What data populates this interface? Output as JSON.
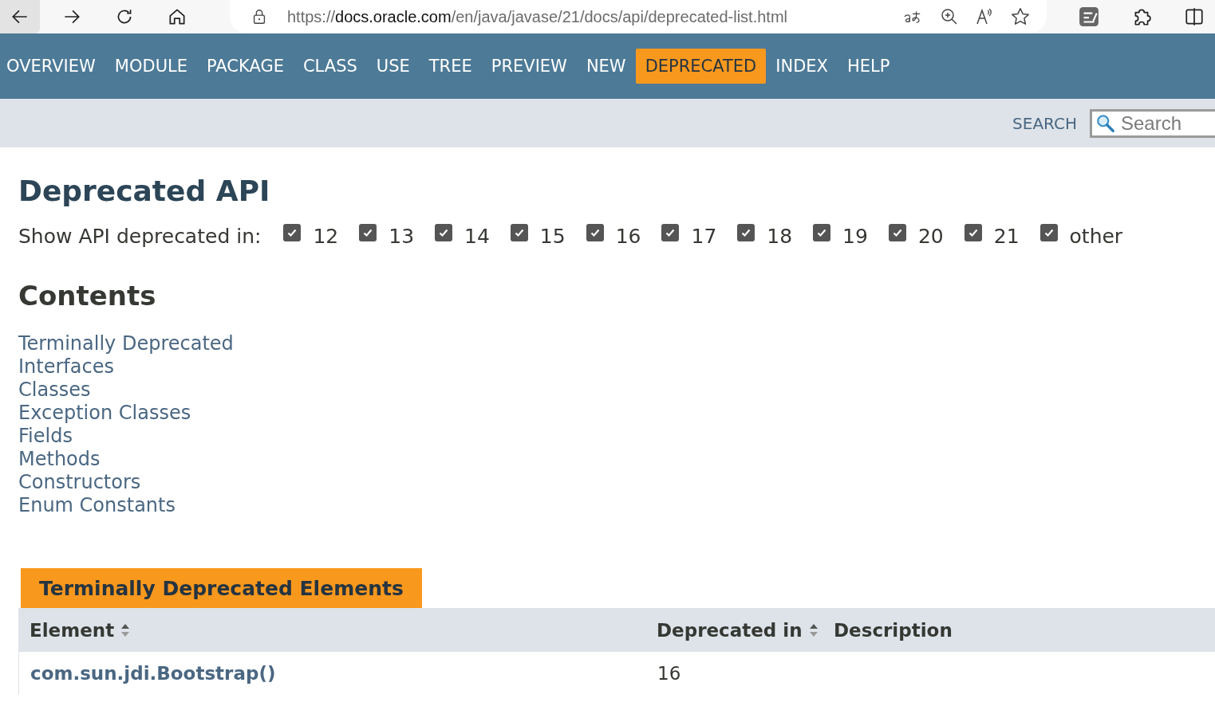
{
  "browser": {
    "url_scheme": "https://",
    "url_host": "docs.oracle.com",
    "url_path": "/en/java/javase/21/docs/api/deprecated-list.html"
  },
  "nav": [
    {
      "label": "OVERVIEW",
      "selected": false
    },
    {
      "label": "MODULE",
      "selected": false
    },
    {
      "label": "PACKAGE",
      "selected": false
    },
    {
      "label": "CLASS",
      "selected": false
    },
    {
      "label": "USE",
      "selected": false
    },
    {
      "label": "TREE",
      "selected": false
    },
    {
      "label": "PREVIEW",
      "selected": false
    },
    {
      "label": "NEW",
      "selected": false
    },
    {
      "label": "DEPRECATED",
      "selected": true
    },
    {
      "label": "INDEX",
      "selected": false
    },
    {
      "label": "HELP",
      "selected": false
    }
  ],
  "search": {
    "label": "SEARCH",
    "placeholder": "Search"
  },
  "title": "Deprecated API",
  "filter": {
    "label": "Show API deprecated in:",
    "options": [
      {
        "label": "12",
        "checked": true
      },
      {
        "label": "13",
        "checked": true
      },
      {
        "label": "14",
        "checked": true
      },
      {
        "label": "15",
        "checked": true
      },
      {
        "label": "16",
        "checked": true
      },
      {
        "label": "17",
        "checked": true
      },
      {
        "label": "18",
        "checked": true
      },
      {
        "label": "19",
        "checked": true
      },
      {
        "label": "20",
        "checked": true
      },
      {
        "label": "21",
        "checked": true
      },
      {
        "label": "other",
        "checked": true
      }
    ]
  },
  "contents": {
    "heading": "Contents",
    "links": [
      "Terminally Deprecated",
      "Interfaces",
      "Classes",
      "Exception Classes",
      "Fields",
      "Methods",
      "Constructors",
      "Enum Constants"
    ]
  },
  "table": {
    "caption": "Terminally Deprecated Elements",
    "columns": [
      "Element",
      "Deprecated in",
      "Description"
    ],
    "rows": [
      {
        "element": "com.sun.jdi.Bootstrap()",
        "deprecated_in": "16"
      }
    ]
  }
}
